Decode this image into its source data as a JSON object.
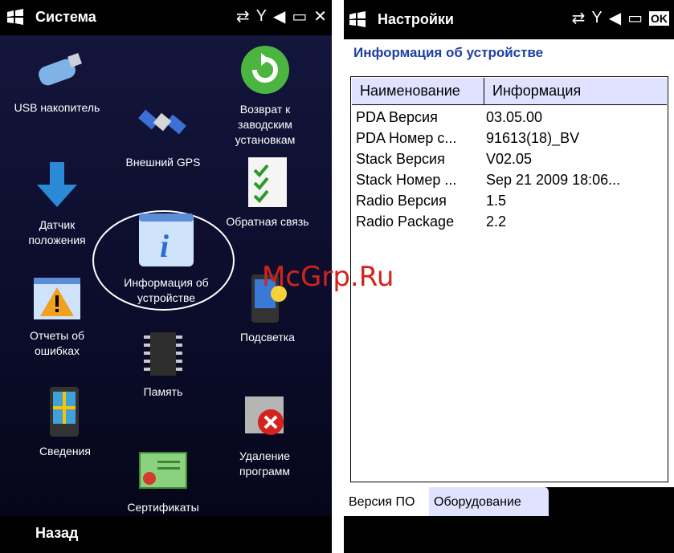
{
  "left": {
    "title": "Система",
    "back": "Назад",
    "tiles": [
      {
        "label": "USB накопитель"
      },
      {
        "label": "Внешний GPS"
      },
      {
        "label": "Возврат к заводским установкам"
      },
      {
        "label": "Датчик положения"
      },
      {
        "label": "Информация об устройстве"
      },
      {
        "label": "Обратная связь"
      },
      {
        "label": "Отчеты об ошибках"
      },
      {
        "label": "Память"
      },
      {
        "label": "Подсветка"
      },
      {
        "label": "Сведения"
      },
      {
        "label": "Сертификаты"
      },
      {
        "label": "Удаление программ"
      }
    ]
  },
  "right": {
    "title": "Настройки",
    "subtitle": "Информация об устройстве",
    "columns": [
      "Наименование",
      "Информация"
    ],
    "rows": [
      [
        "PDA Версия",
        "03.05.00"
      ],
      [
        "PDA Номер с...",
        "91613(18)_BV"
      ],
      [
        "Stack Версия",
        "V02.05"
      ],
      [
        "Stack Номер ...",
        "Sep 21 2009 18:06..."
      ],
      [
        "Radio Версия",
        "1.5"
      ],
      [
        "Radio Package",
        "2.2"
      ]
    ],
    "tabs": [
      "Версия ПО",
      "Оборудование"
    ]
  },
  "status_icons": [
    "sync-icon",
    "signal-icon",
    "speaker-icon",
    "battery-icon"
  ],
  "close_label": "OK",
  "watermark": "McGrp.Ru"
}
